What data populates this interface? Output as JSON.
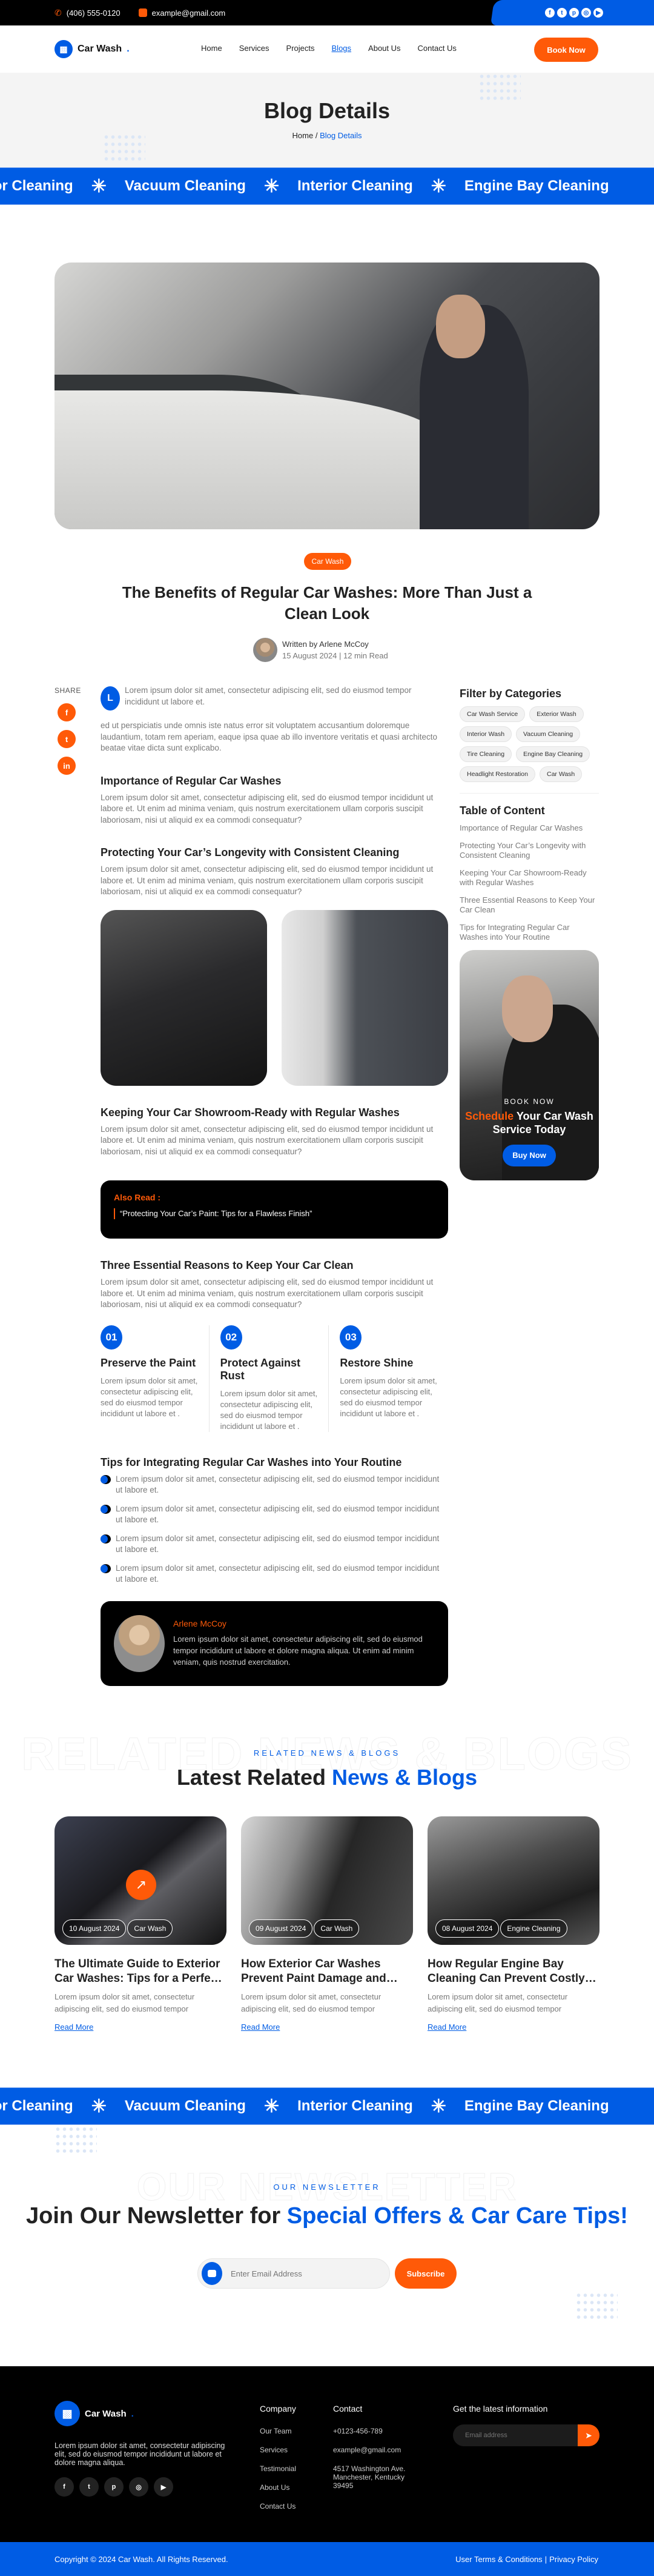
{
  "topbar": {
    "phone": "(406) 555-0120",
    "email": "example@gmail.com",
    "social_icons": [
      "facebook-icon",
      "twitter-icon",
      "pinterest-icon",
      "instagram-icon",
      "youtube-icon"
    ]
  },
  "nav": {
    "logo_text": "Car Wash",
    "logo_dot": ".",
    "items": [
      {
        "label": "Home"
      },
      {
        "label": "Services"
      },
      {
        "label": "Projects"
      },
      {
        "label": "Blogs",
        "active": true
      },
      {
        "label": "About Us"
      },
      {
        "label": "Contact Us"
      }
    ],
    "cta": "Book Now"
  },
  "banner": {
    "title": "Blog Details",
    "breadcrumb": {
      "home": "Home",
      "separator": "/",
      "current": "Blog Details"
    }
  },
  "marquee": {
    "items": [
      "Exterior Cleaning",
      "Vacuum Cleaning",
      "Interior Cleaning",
      "Engine Bay Cleaning"
    ],
    "separator": "✳"
  },
  "post": {
    "category": "Car Wash",
    "title": "The Benefits of Regular Car Washes: More Than Just a Clean Look",
    "author_line": "Written by Arlene McCoy",
    "date": "15 August 2024",
    "read_time": "12 min Read",
    "share_label": "SHARE",
    "dropcap": "L",
    "intro": "Lorem ipsum dolor sit amet, consectetur adipiscing elit, sed do eiusmod tempor incididunt ut labore et.",
    "intro2": "ed ut perspiciatis unde omnis iste natus error sit voluptatem accusantium doloremque laudantium, totam rem aperiam, eaque ipsa quae ab illo inventore veritatis et quasi architecto beatae vitae dicta sunt explicabo.",
    "sections": [
      {
        "heading": "Importance of Regular Car Washes",
        "body": "Lorem ipsum dolor sit amet, consectetur adipiscing elit, sed do eiusmod tempor incididunt ut labore et. Ut enim ad minima veniam, quis nostrum exercitationem ullam corporis suscipit laboriosam, nisi ut aliquid ex ea commodi consequatur?"
      },
      {
        "heading": "Protecting Your Car’s Longevity with Consistent Cleaning",
        "body": "Lorem ipsum dolor sit amet, consectetur adipiscing elit, sed do eiusmod tempor incididunt ut labore et. Ut enim ad minima veniam, quis nostrum exercitationem ullam corporis suscipit laboriosam, nisi ut aliquid ex ea commodi consequatur?"
      },
      {
        "heading": "Keeping Your Car Showroom-Ready with Regular Washes",
        "body": "Lorem ipsum dolor sit amet, consectetur adipiscing elit, sed do eiusmod tempor incididunt ut labore et. Ut enim ad minima veniam, quis nostrum exercitationem ullam corporis suscipit laboriosam, nisi ut aliquid ex ea commodi consequatur?"
      },
      {
        "heading": "Three Essential Reasons to Keep Your Car Clean",
        "body": "Lorem ipsum dolor sit amet, consectetur adipiscing elit, sed do eiusmod tempor incididunt ut labore et. Ut enim ad minima veniam, quis nostrum exercitationem ullam corporis suscipit laboriosam, nisi ut aliquid ex ea commodi consequatur?"
      },
      {
        "heading": "Tips for Integrating Regular Car Washes into Your Routine"
      }
    ],
    "also_read": {
      "label": "Also Read :",
      "quote": "“Protecting Your Car’s Paint: Tips for a Flawless Finish”"
    },
    "reasons": [
      {
        "num": "01",
        "title": "Preserve the Paint",
        "body": "Lorem ipsum dolor sit amet, consectetur adipiscing elit, sed do eiusmod tempor incididunt ut labore et ."
      },
      {
        "num": "02",
        "title": "Protect Against Rust",
        "body": "Lorem ipsum dolor sit amet, consectetur adipiscing elit, sed do eiusmod tempor incididunt ut labore et ."
      },
      {
        "num": "03",
        "title": "Restore Shine",
        "body": "Lorem ipsum dolor sit amet, consectetur adipiscing elit, sed do eiusmod tempor incididunt ut labore et ."
      }
    ],
    "tips": [
      "Lorem ipsum dolor sit amet, consectetur adipiscing elit, sed do eiusmod tempor incididunt ut labore et.",
      "Lorem ipsum dolor sit amet, consectetur adipiscing elit, sed do eiusmod tempor incididunt ut labore et.",
      "Lorem ipsum dolor sit amet, consectetur adipiscing elit, sed do eiusmod tempor incididunt ut labore et.",
      "Lorem ipsum dolor sit amet, consectetur adipiscing elit, sed do eiusmod tempor incididunt ut labore et."
    ],
    "author_box": {
      "name": "Arlene McCoy",
      "bio": "Lorem ipsum dolor sit amet, consectetur adipiscing elit, sed do eiusmod tempor incididunt ut labore et dolore magna aliqua. Ut enim ad minim veniam, quis nostrud exercitation."
    }
  },
  "sidebar": {
    "categories_title": "Filter by Categories",
    "categories": [
      "Car Wash Service",
      "Exterior Wash",
      "Interior Wash",
      "Vacuum Cleaning",
      "Tire Cleaning",
      "Engine Bay Cleaning",
      "Headlight Restoration",
      "Car Wash"
    ],
    "toc_title": "Table of Content",
    "toc": [
      "Importance of Regular Car Washes",
      "Protecting Your Car’s Longevity with Consistent Cleaning",
      "Keeping Your Car Showroom-Ready with Regular Washes",
      "Three Essential Reasons to Keep Your Car Clean",
      "Tips for Integrating Regular Car Washes into Your Routine"
    ],
    "promo": {
      "kicker": "BOOK NOW",
      "highlight": "Schedule",
      "title_rest": " Your Car Wash Service Today",
      "button": "Buy Now"
    }
  },
  "related": {
    "outline_text": "RELATED NEWS & BLOGS",
    "kicker": "RELATED NEWS & BLOGS",
    "title_plain": "Latest Related ",
    "title_accent": "News & Blogs",
    "cards": [
      {
        "date": "10 August 2024",
        "tag": "Car Wash",
        "title": "The Ultimate Guide to Exterior Car Washes: Tips for a Perfect Shine",
        "excerpt": "Lorem ipsum dolor sit amet, consectetur adipiscing elit, sed do eiusmod tempor",
        "link": "Read More"
      },
      {
        "date": "09 August 2024",
        "tag": "Car Wash",
        "title": "How Exterior Car Washes Prevent Paint Damage and Extend Life",
        "excerpt": "Lorem ipsum dolor sit amet, consectetur adipiscing elit, sed do eiusmod tempor",
        "link": "Read More"
      },
      {
        "date": "08 August 2024",
        "tag": "Engine Cleaning",
        "title": "How Regular Engine Bay Cleaning Can Prevent Costly Repairs",
        "excerpt": "Lorem ipsum dolor sit amet, consectetur adipiscing elit, sed do eiusmod tempor",
        "link": "Read More"
      }
    ]
  },
  "newsletter": {
    "outline_text": "OUR NEWSLETTER",
    "kicker": "OUR NEWSLETTER",
    "title_plain": "Join Our Newsletter for ",
    "title_accent": "Special Offers & Car Care Tips!",
    "placeholder": "Enter Email Address",
    "button": "Subscribe"
  },
  "footer": {
    "logo_text": "Car Wash",
    "description": "Lorem ipsum dolor sit amet, consectetur adipiscing elit, sed do eiusmod tempor incididunt ut labore et dolore magna aliqua.",
    "company_title": "Company",
    "company_links": [
      "Our Team",
      "Services",
      "Testimonial",
      "About Us",
      "Contact Us"
    ],
    "contact_title": "Contact",
    "contact": [
      "+0123-456-789",
      "example@gmail.com",
      "4517 Washington Ave. Manchester, Kentucky 39495"
    ],
    "newsletter_title": "Get the latest information",
    "newsletter_placeholder": "Email address",
    "copyright": "Copyright © 2024 Car Wash. All Rights Reserved.",
    "terms": "User Terms & Conditions",
    "privacy": "Privacy Policy"
  },
  "colors": {
    "primary": "#005ce4",
    "accent": "#ff5a08",
    "dark": "#000000",
    "banner_bg": "#f4f4f4"
  }
}
